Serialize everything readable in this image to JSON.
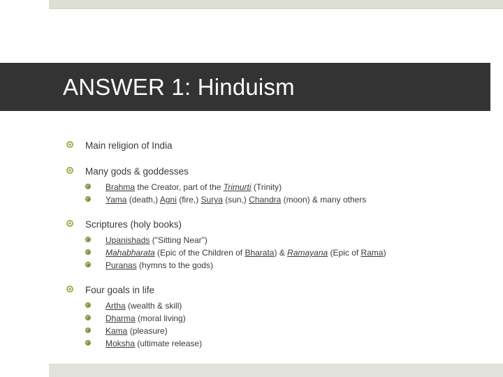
{
  "slide": {
    "title": "ANSWER 1: Hinduism",
    "accent_band_color": "#dee0d6",
    "title_bar_color": "#333333",
    "bullet_color": "#a8ac4d",
    "text_color": "#3a3a3a"
  },
  "bullets": [
    {
      "icon": "ring-bullet-icon",
      "text": "Main religion of India",
      "children": []
    },
    {
      "icon": "ring-bullet-icon",
      "text": "Many gods & goddesses",
      "children": [
        {
          "icon": "ring-bullet-icon",
          "parts": [
            {
              "t": "Brahma",
              "style": "underline"
            },
            {
              "t": " the Creator, part of the ",
              "style": "plain"
            },
            {
              "t": "Trimurti",
              "style": "underline-italic"
            },
            {
              "t": " (Trinity)",
              "style": "plain"
            }
          ],
          "plain": "Brahma the Creator, part of the Trimurti (Trinity)"
        },
        {
          "icon": "ring-bullet-icon",
          "parts": [
            {
              "t": "Yama",
              "style": "underline"
            },
            {
              "t": " (death,) ",
              "style": "plain"
            },
            {
              "t": "Agni",
              "style": "underline"
            },
            {
              "t": " (fire,) ",
              "style": "plain"
            },
            {
              "t": "Surya",
              "style": "underline"
            },
            {
              "t": " (sun,) ",
              "style": "plain"
            },
            {
              "t": "Chandra",
              "style": "underline"
            },
            {
              "t": " (moon) & many others",
              "style": "plain"
            }
          ],
          "plain": "Yama (death,) Agni (fire,) Surya (sun,) Chandra (moon) & many others"
        }
      ]
    },
    {
      "icon": "ring-bullet-icon",
      "text": "Scriptures (holy books)",
      "children": [
        {
          "icon": "ring-bullet-icon",
          "parts": [
            {
              "t": "Upanishads",
              "style": "underline"
            },
            {
              "t": " (\"Sitting Near\")",
              "style": "plain"
            }
          ],
          "plain": "Upanishads (\"Sitting Near\")"
        },
        {
          "icon": "ring-bullet-icon",
          "parts": [
            {
              "t": "Mahabharata",
              "style": "underline-italic"
            },
            {
              "t": " (Epic of the Children of ",
              "style": "plain"
            },
            {
              "t": "Bharata",
              "style": "underline"
            },
            {
              "t": ") & ",
              "style": "plain"
            },
            {
              "t": "Ramayana",
              "style": "underline-italic"
            },
            {
              "t": " (Epic of ",
              "style": "plain"
            },
            {
              "t": "Rama",
              "style": "underline"
            },
            {
              "t": ")",
              "style": "plain"
            }
          ],
          "plain": "Mahabharata (Epic of the Children of Bharata) & Ramayana (Epic of Rama)"
        },
        {
          "icon": "ring-bullet-icon",
          "parts": [
            {
              "t": "Puranas",
              "style": "underline"
            },
            {
              "t": " (hymns to the gods)",
              "style": "plain"
            }
          ],
          "plain": "Puranas (hymns to the gods)"
        }
      ]
    },
    {
      "icon": "ring-bullet-icon",
      "text": "Four goals in life",
      "children": [
        {
          "icon": "ring-bullet-icon",
          "parts": [
            {
              "t": "Artha",
              "style": "underline"
            },
            {
              "t": " (wealth & skill)",
              "style": "plain"
            }
          ],
          "plain": "Artha (wealth & skill)"
        },
        {
          "icon": "ring-bullet-icon",
          "parts": [
            {
              "t": "Dharma",
              "style": "underline"
            },
            {
              "t": " (moral living)",
              "style": "plain"
            }
          ],
          "plain": "Dharma (moral living)"
        },
        {
          "icon": "ring-bullet-icon",
          "parts": [
            {
              "t": "Kama",
              "style": "underline"
            },
            {
              "t": " (pleasure)",
              "style": "plain"
            }
          ],
          "plain": "Kama (pleasure)"
        },
        {
          "icon": "ring-bullet-icon",
          "parts": [
            {
              "t": "Moksha",
              "style": "underline"
            },
            {
              "t": " (ultimate release)",
              "style": "plain"
            }
          ],
          "plain": "Moksha (ultimate release)"
        }
      ]
    }
  ]
}
